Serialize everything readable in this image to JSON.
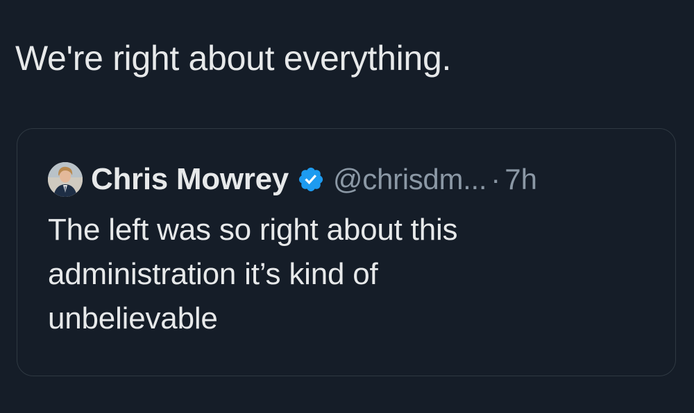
{
  "tweet": {
    "text": "We're right about everything."
  },
  "quoted_tweet": {
    "author_name": "Chris Mowrey",
    "verified": true,
    "handle": "@chrisdm...",
    "separator": "·",
    "time": "7h",
    "body_lines": [
      "The left was so right about this",
      "administration it’s kind of",
      "unbelievable"
    ]
  },
  "colors": {
    "background": "#151d28",
    "text_primary": "#e7e9ea",
    "text_secondary": "#8b98a5",
    "border": "#2f3942",
    "verified_badge": "#1d9bf0"
  },
  "icons": {
    "verified": "verified-badge-icon",
    "avatar": "profile-avatar"
  }
}
